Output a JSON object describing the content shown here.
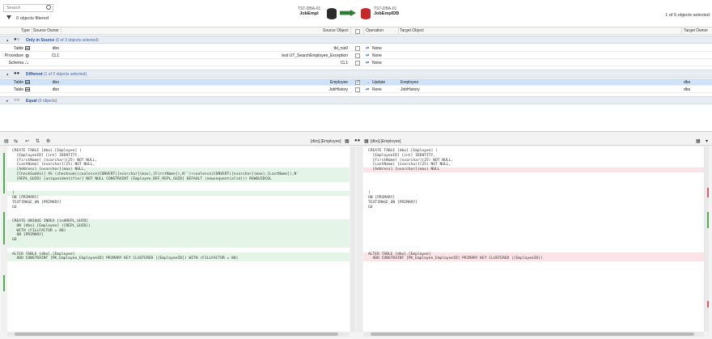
{
  "search": {
    "placeholder": "Search",
    "value": ""
  },
  "filter": {
    "text": "0 objects filtered"
  },
  "source": {
    "server": "TST-DBA-01",
    "database": "JobEmpl"
  },
  "target": {
    "server": "TST-DBA-01",
    "database": "JobEmplDB"
  },
  "summary": {
    "count_text": "1 of 5 objects selected"
  },
  "columns": {
    "type": "Type",
    "source_owner": "Source Owner",
    "source_object": "Source Object",
    "operation": "Operation",
    "target_object": "Target Object",
    "target_owner": "Target Owner"
  },
  "groups": [
    {
      "title": "Only in Source",
      "count": "(0 of 3 objects selected)",
      "rows": [
        {
          "type": "Table",
          "owner": "dbo",
          "object": "tbl_rss0",
          "operation": "None",
          "target_object": "",
          "target_owner": ""
        },
        {
          "type": "Procedure",
          "owner": "CL1",
          "object": "test UT_SearchEmployee_Exception",
          "operation": "None",
          "target_object": "",
          "target_owner": ""
        },
        {
          "type": "Schema",
          "owner": "",
          "object": "CL1",
          "operation": "None",
          "target_object": "",
          "target_owner": ""
        }
      ]
    },
    {
      "title": "Different",
      "count": "(1 of 2 objects selected)",
      "rows": [
        {
          "type": "Table",
          "owner": "dbo",
          "object": "Employee",
          "operation": "Update",
          "target_object": "Employee",
          "target_owner": "dbo",
          "checked": true
        },
        {
          "type": "Table",
          "owner": "dbo",
          "object": "JobHistory",
          "operation": "None",
          "target_object": "JobHistory",
          "target_owner": "dbo"
        }
      ]
    },
    {
      "title": "Equal",
      "count": "(0 objects)"
    }
  ],
  "diff": {
    "left_title": "[dbo].[Employee]",
    "right_title": "[dbo].[Employee]",
    "left_lines": [
      "CREATE TABLE [dbo].[Employee] (",
      "  [EmployeeID] [int] IDENTITY,",
      "  [FirstName] [nvarchar](25) NOT NULL,",
      "  [LastName] [nvarchar](25) NOT NULL,",
      "  [Address] [nvarchar](max) NULL,",
      "  [CheckSumVal] AS (checksum((coalesce(CONVERT([nvarchar](max),[FirstName]),N'')+coalesce(CONVERT([nvarchar](max),[LastName]),N'",
      "  [REPL_GUID] [uniqueidentifier] NOT NULL CONSTRAINT [Employee_DEF_REPL_GUID] DEFAULT (newsequentialid()) ROWGUIDCOL",
      ")",
      "ON [PRIMARY]",
      "TEXTIMAGE_ON [PRIMARY]",
      "GO",
      "",
      "CREATE UNIQUE INDEX [indREPL_GUID]",
      "  ON [dbo].[Employee] ([REPL_GUID])",
      "  WITH (FILLFACTOR = 80)",
      "  ON [PRIMARY]",
      "GO",
      "",
      "ALTER TABLE [dbo].[Employee]",
      "  ADD CONSTRAINT [PK_Employee_EmployeeID] PRIMARY KEY CLUSTERED ([EmployeeID]) WITH (FILLFACTOR = 80)"
    ],
    "right_lines": [
      "CREATE TABLE [dbo].[Employee] (",
      "  [EmployeeID] [int] IDENTITY,",
      "  [FirstName] [nvarchar](25) NOT NULL,",
      "  [LastName] [nvarchar](25) NOT NULL,",
      "  [Address] [nvarchar](max) NULL",
      "",
      "",
      ")",
      "ON [PRIMARY]",
      "TEXTIMAGE_ON [PRIMARY]",
      "GO",
      "",
      "",
      "",
      "",
      "",
      "",
      "",
      "ALTER TABLE [dbo].[Employee]",
      "  ADD CONSTRAINT [PK_Employee_EmployeeID] PRIMARY KEY CLUSTERED ([EmployeeID])"
    ]
  }
}
